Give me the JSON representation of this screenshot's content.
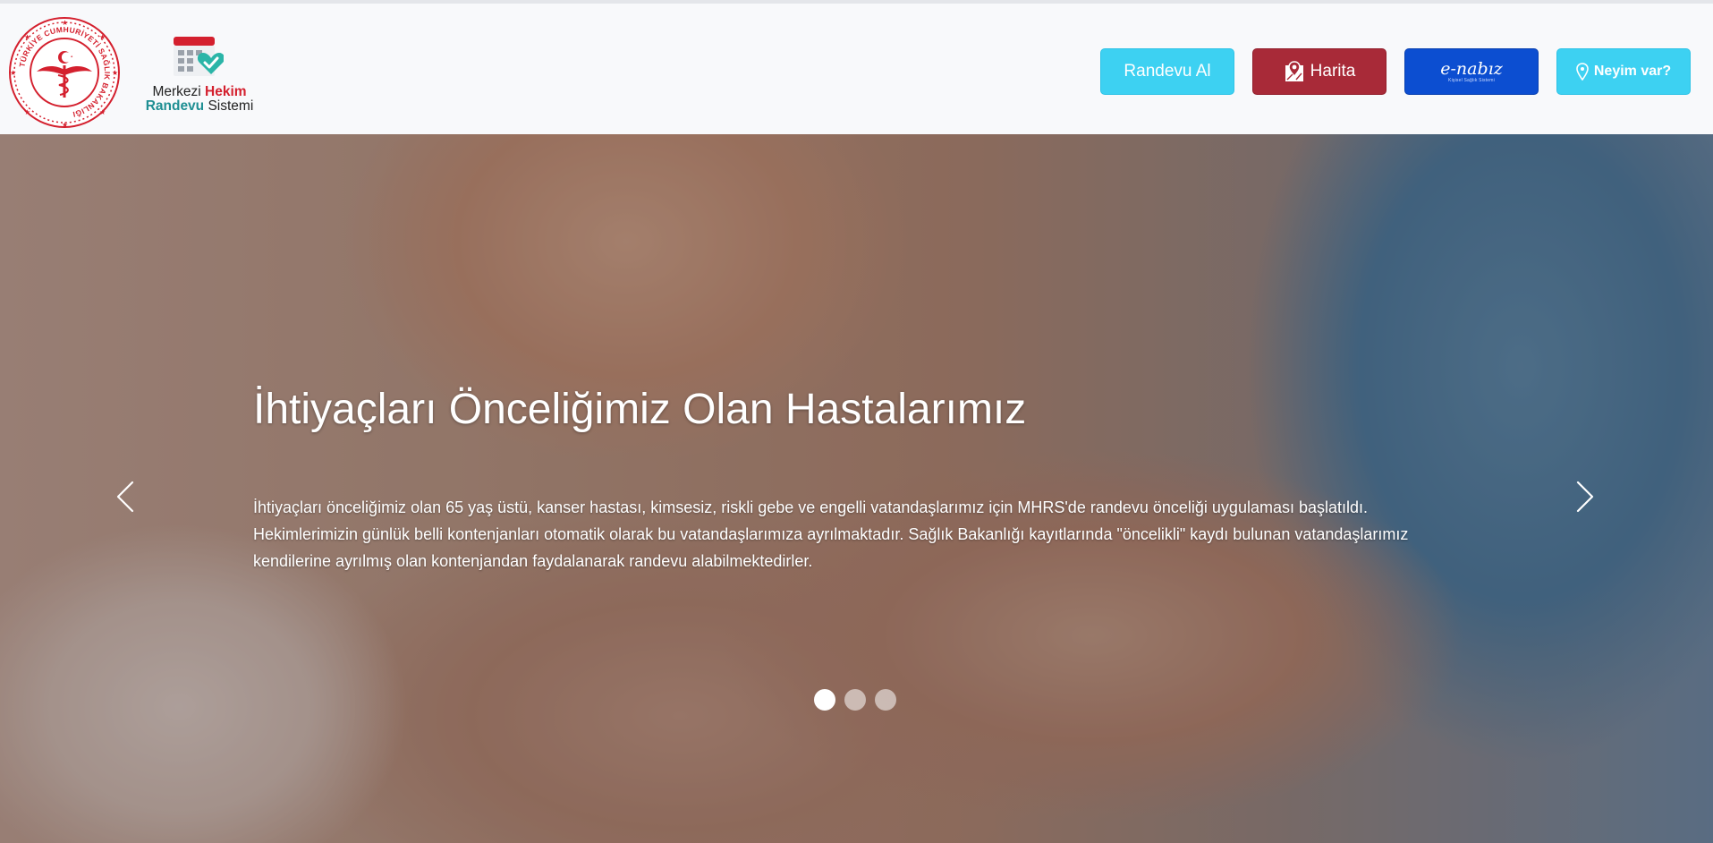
{
  "header": {
    "seal_text": "TÜRKİYE CUMHURİYETİ SAĞLIK BAKANLIĞI",
    "brand": {
      "word1": "Merkezi",
      "word2": "Hekim",
      "word3": "Randevu",
      "word4": "Sistemi"
    },
    "nav": {
      "randevu_label": "Randevu Al",
      "harita_label": "Harita",
      "enabiz_label": "e-nabız",
      "enabiz_sub": "Kişisel Sağlık Sistemi",
      "neyim_label": "Neyim var?"
    }
  },
  "hero": {
    "title": "İhtiyaçları Önceliğimiz Olan Hastalarımız",
    "text": "İhtiyaçları önceliğimiz olan 65 yaş üstü, kanser hastası, kimsesiz, riskli gebe ve engelli vatandaşlarımız için MHRS'de randevu önceliği uygulaması başlatıldı. Hekimlerimizin günlük belli kontenjanları otomatik olarak bu vatandaşlarımıza ayrılmaktadır. Sağlık Bakanlığı kayıtlarında \"öncelikli\" kaydı bulunan vatandaşlarımız kendilerine ayrılmış olan kontenjandan faydalanarak randevu alabilmektedirler.",
    "slides_total": 3,
    "active_slide": 1
  },
  "colors": {
    "randevu_btn": "#3dd1f2",
    "harita_btn": "#a82a38",
    "enabiz_btn": "#0c4ed1",
    "neyim_btn": "#3dd1f2",
    "seal_red": "#d4202e",
    "brand_teal": "#1f8f93"
  },
  "icons": {
    "prev": "chevron-left-icon",
    "next": "chevron-right-icon",
    "map": "map-pin-icon",
    "neyim": "question-pin-icon",
    "calendar": "calendar-heart-icon"
  }
}
